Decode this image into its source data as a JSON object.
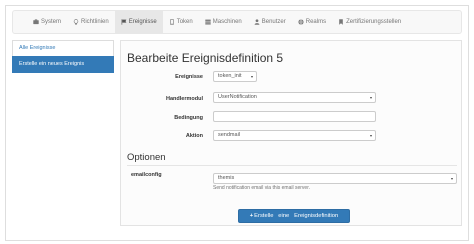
{
  "nav": {
    "items": [
      {
        "label": "System",
        "icon": "dashboard-icon"
      },
      {
        "label": "Richtlinien",
        "icon": "lightbulb-icon"
      },
      {
        "label": "Ereignisse",
        "icon": "flag-icon",
        "active": true
      },
      {
        "label": "Token",
        "icon": "phone-icon"
      },
      {
        "label": "Maschinen",
        "icon": "server-icon"
      },
      {
        "label": "Benutzer",
        "icon": "user-icon"
      },
      {
        "label": "Realms",
        "icon": "globe-icon"
      },
      {
        "label": "Zertifizierungsstellen",
        "icon": "bookmark-icon"
      }
    ]
  },
  "sidebar": {
    "items": [
      {
        "label": "Alle Ereignisse"
      },
      {
        "label": "Erstelle ein neues Ereignis",
        "active": true
      }
    ]
  },
  "main": {
    "title": "Bearbeite Ereignisdefinition 5",
    "fields": {
      "ereignisse": {
        "label": "Ereignisse",
        "value": "token_init"
      },
      "handlermodul": {
        "label": "Handlermodul",
        "value": "UserNotification"
      },
      "bedingung": {
        "label": "Bedingung",
        "value": ""
      },
      "aktion": {
        "label": "Aktion",
        "value": "sendmail"
      }
    },
    "options_title": "Optionen",
    "emailconfig": {
      "label": "emailconfig",
      "value": "themis",
      "help": "Send notification email via this email server."
    },
    "submit": {
      "label": "Erstelle   eine   Ereignisdefinition"
    }
  },
  "colors": {
    "primary": "#337ab7",
    "navbar": "#f8f8f8"
  }
}
